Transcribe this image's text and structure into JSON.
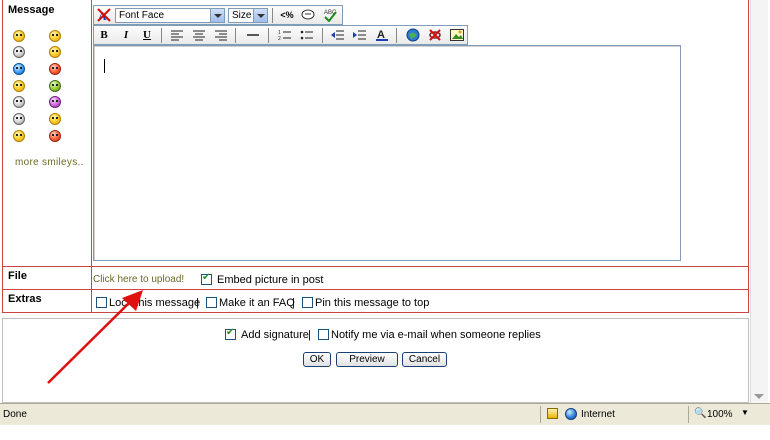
{
  "form": {
    "message_label": "Message",
    "file_label": "File",
    "extras_label": "Extras",
    "more_smileys": "more smileys..",
    "upload_link": "Click here to upload!",
    "embed_label": "Embed picture in post",
    "lock_label": "Lock this message",
    "faq_label": "Make it an FAQ",
    "pin_label": "Pin this message to top",
    "add_signature_label": "Add signature",
    "notify_label": "Notify me via e-mail when someone replies",
    "sep": "|"
  },
  "toolbar": {
    "font_face": "Font Face",
    "size": "Size",
    "bold": "B",
    "italic": "I",
    "underline": "U"
  },
  "buttons": {
    "ok": "OK",
    "preview": "Preview",
    "cancel": "Cancel"
  },
  "status": {
    "left": "Done",
    "zone": "Internet",
    "zoom": "100%"
  },
  "colors": {
    "accent_red": "#cc4444",
    "link_olive": "#6b6b2a",
    "arrow_red": "#e01010"
  }
}
